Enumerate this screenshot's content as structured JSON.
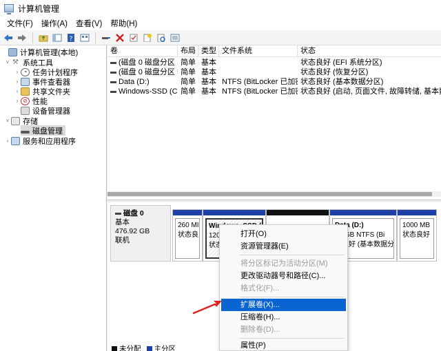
{
  "window": {
    "title": "计算机管理"
  },
  "menu": [
    "文件(F)",
    "操作(A)",
    "查看(V)",
    "帮助(H)"
  ],
  "toolbar": {
    "icons": [
      "back-icon",
      "forward-icon",
      "up-folder-icon",
      "show-hide-tree-icon",
      "help-icon",
      "properties-icon",
      "connect-drive-icon",
      "delete-icon",
      "check-icon",
      "new-folder-icon",
      "search-icon",
      "list-icon"
    ]
  },
  "tree": {
    "root": "计算机管理(本地)",
    "system_tools": "系统工具",
    "task_scheduler": "任务计划程序",
    "event_viewer": "事件查看器",
    "shared_folders": "共享文件夹",
    "performance": "性能",
    "device_manager": "设备管理器",
    "storage": "存储",
    "disk_management": "磁盘管理",
    "services_apps": "服务和应用程序"
  },
  "volumes": {
    "headers": [
      "卷",
      "布局",
      "类型",
      "文件系统",
      "状态"
    ],
    "rows": [
      [
        "(磁盘 0 磁盘分区 1)",
        "简单",
        "基本",
        "",
        "状态良好 (EFI 系统分区)"
      ],
      [
        "(磁盘 0 磁盘分区 5)",
        "简单",
        "基本",
        "",
        "状态良好 (恢复分区)"
      ],
      [
        "Data (D:)",
        "简单",
        "基本",
        "NTFS (BitLocker 已加密)",
        "状态良好 (基本数据分区)"
      ],
      [
        "Windows-SSD (C:)",
        "简单",
        "基本",
        "NTFS (BitLocker 已加密)",
        "状态良好 (启动, 页面文件, 故障转储, 基本数据分"
      ]
    ]
  },
  "disk": {
    "name": "磁盘 0",
    "type": "基本",
    "size": "476.92 GB",
    "status": "联机",
    "partitions": [
      {
        "line1": "260 MI",
        "line2": "状态良",
        "line3": ""
      },
      {
        "line1": "Windows_SSD  (C",
        "line2": "120",
        "line3": "状态"
      },
      {
        "line1": "",
        "line2": "",
        "line3": ""
      },
      {
        "line1": "Data  (D:)",
        "line2": "59 GB NTFS (Bi",
        "line3": "态良好 (基本数据分"
      },
      {
        "line1": "1000 MB",
        "line2": "状态良好",
        "line3": ""
      }
    ]
  },
  "legend": {
    "unallocated": "未分配",
    "primary": "主分区"
  },
  "context_menu": {
    "items": [
      {
        "label": "打开(O)",
        "disabled": false
      },
      {
        "label": "资源管理器(E)",
        "disabled": false
      },
      {
        "label": "将分区标记为活动分区(M)",
        "disabled": true
      },
      {
        "label": "更改驱动器号和路径(C)...",
        "disabled": false
      },
      {
        "label": "格式化(F)...",
        "disabled": true
      },
      {
        "label": "扩展卷(X)...",
        "disabled": false,
        "highlighted": true
      },
      {
        "label": "压缩卷(H)...",
        "disabled": false
      },
      {
        "label": "删除卷(D)...",
        "disabled": true
      },
      {
        "label": "属性(P)",
        "disabled": false
      }
    ]
  },
  "colors": {
    "primary_partition": "#1f3fa8",
    "highlight": "#0a64d2",
    "annotation_arrow": "#e02020"
  }
}
